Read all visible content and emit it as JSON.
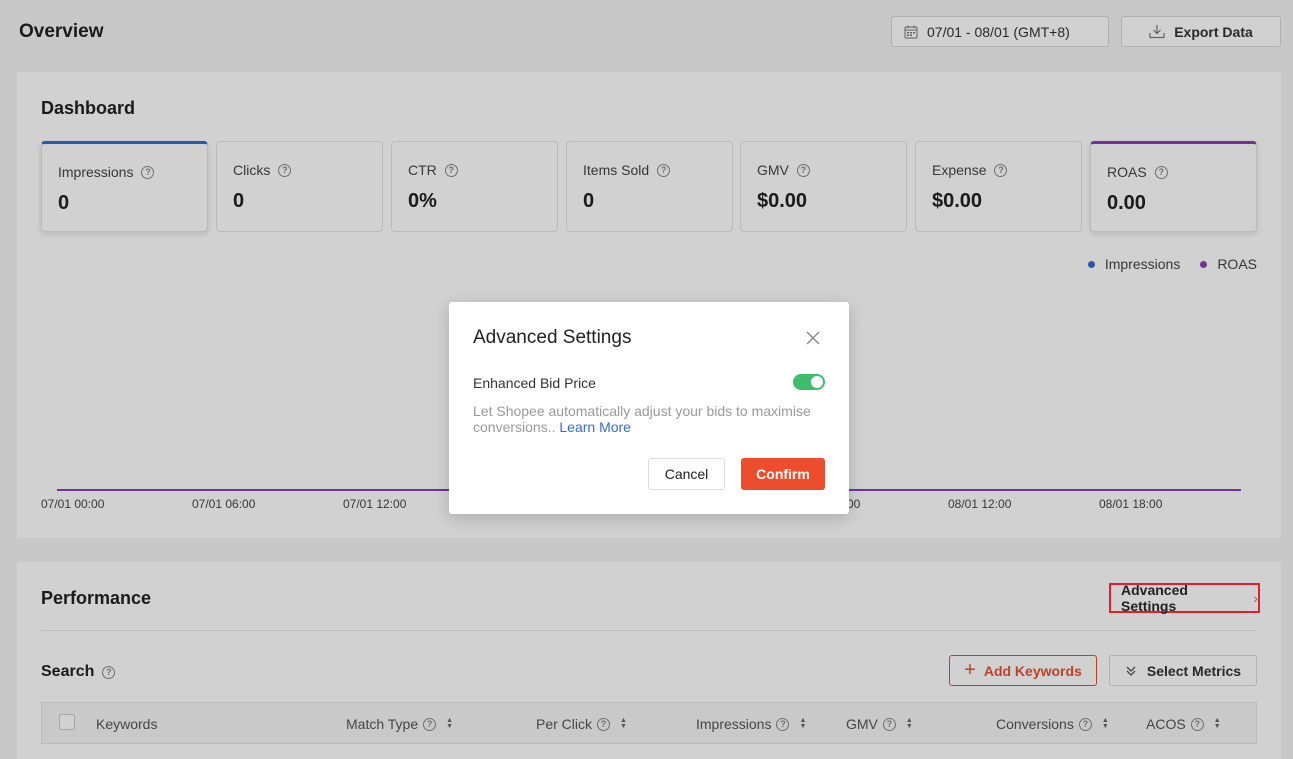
{
  "header": {
    "title": "Overview",
    "date_range": "07/01 - 08/01 (GMT+8)",
    "export_label": "Export Data"
  },
  "dashboard": {
    "title": "Dashboard",
    "metrics": [
      {
        "label": "Impressions",
        "value": "0"
      },
      {
        "label": "Clicks",
        "value": "0"
      },
      {
        "label": "CTR",
        "value": "0%"
      },
      {
        "label": "Items Sold",
        "value": "0"
      },
      {
        "label": "GMV",
        "value": "$0.00"
      },
      {
        "label": "Expense",
        "value": "$0.00"
      },
      {
        "label": "ROAS",
        "value": "0.00"
      }
    ],
    "legend": [
      {
        "label": "Impressions",
        "color": "#2f6bd8"
      },
      {
        "label": "ROAS",
        "color": "#8a3fb8"
      }
    ],
    "x_ticks": [
      "07/01 00:00",
      "07/01 06:00",
      "07/01 12:00",
      "00",
      "08/01 12:00",
      "08/01 18:00"
    ]
  },
  "performance": {
    "title": "Performance",
    "advanced_settings_label": "Advanced Settings",
    "search_title": "Search",
    "add_keywords_label": "Add Keywords",
    "select_metrics_label": "Select Metrics",
    "columns": [
      "Keywords",
      "Match Type",
      "Per Click",
      "Impressions",
      "GMV",
      "Conversions",
      "ACOS"
    ]
  },
  "modal": {
    "title": "Advanced Settings",
    "setting_label": "Enhanced Bid Price",
    "toggle_on": true,
    "description": "Let Shopee automatically adjust your bids to maximise conversions..",
    "learn_more": "Learn More",
    "cancel_label": "Cancel",
    "confirm_label": "Confirm"
  },
  "colors": {
    "accent": "#ee4d2d",
    "toggle_on": "#3fbd6a",
    "link": "#2f6bd8",
    "highlight": "#e0202e"
  }
}
